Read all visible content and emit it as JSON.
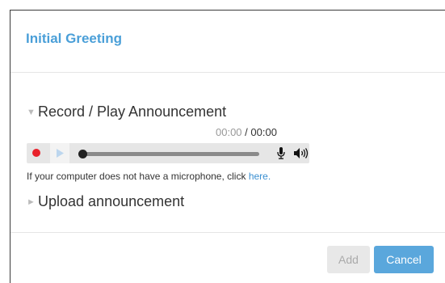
{
  "dialog": {
    "title": "Initial Greeting"
  },
  "record_section": {
    "label": "Record / Play Announcement",
    "time_current": "00:00",
    "time_separator": " / ",
    "time_total": "00:00",
    "progress_fraction": 0,
    "icons": {
      "record": "record-dot-icon",
      "play": "play-icon",
      "mic": "microphone-icon",
      "volume": "volume-icon"
    },
    "colors": {
      "record": "#e8212b"
    }
  },
  "microphone_note": {
    "text": "If your computer does not have a microphone, click ",
    "link": "here."
  },
  "upload_section": {
    "label": "Upload announcement"
  },
  "footer": {
    "add_label": "Add",
    "cancel_label": "Cancel"
  },
  "colors": {
    "accent": "#4a9fd8",
    "cancel_bg": "#5aa7dc"
  }
}
